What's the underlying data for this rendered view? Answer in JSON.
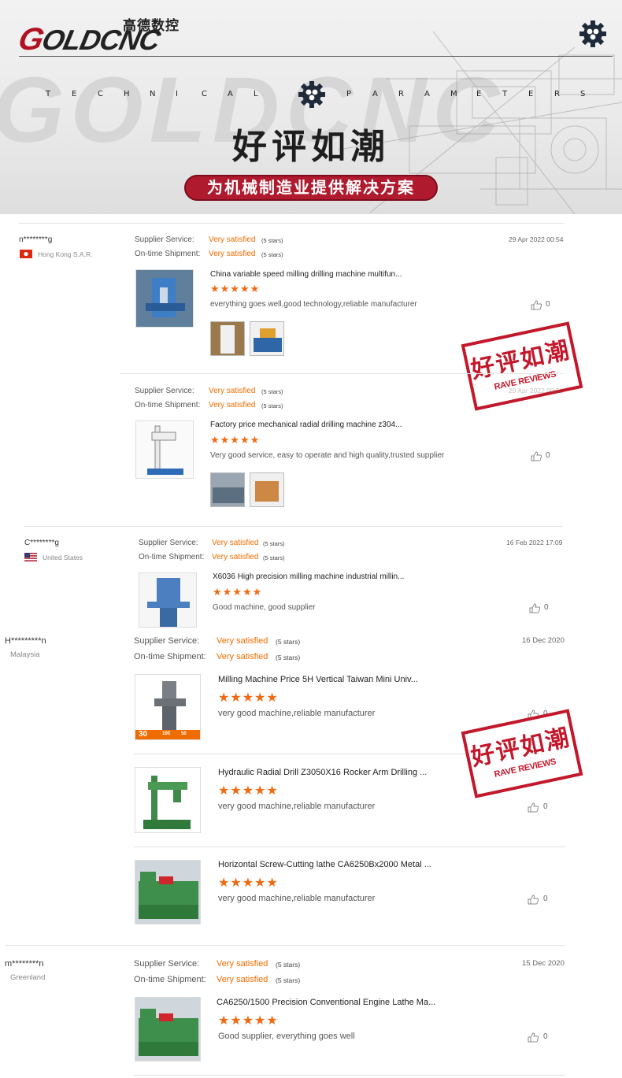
{
  "brand": {
    "logo_cn": "高德数控",
    "logo_en": "GOLDCNC",
    "watermark": "GOLDCNC",
    "red": "#b01224",
    "orange": "#ef6c00"
  },
  "banner": {
    "tech_letters_left": [
      "T",
      "E",
      "C",
      "H",
      "N",
      "I",
      "C",
      "A",
      "L"
    ],
    "tech_letters_right": [
      "P",
      "A",
      "R",
      "A",
      "M",
      "E",
      "T",
      "E",
      "R",
      "S"
    ],
    "slogan": "好评如潮",
    "pill": "为机械制造业提供解决方案"
  },
  "stamp": {
    "title": "好评如潮",
    "subtitle": "RAVE REVIEWS"
  },
  "labels": {
    "supplier": "Supplier Service:",
    "shipment": "On-time Shipment:",
    "very": "Very satisfied",
    "five": "(5 stars)",
    "stars": "★★★★★"
  },
  "reviews": [
    {
      "user": "n********g",
      "country": "Hong Kong S.A.R.",
      "date": "29 Apr 2022 00:54",
      "items": [
        {
          "title": "China variable speed milling drilling machine multifun...",
          "text": "everything goes well,good technology,reliable manufacturer",
          "likes": "0"
        },
        {
          "title": "Factory price mechanical radial drilling machine z304...",
          "text": "Very good service, easy to operate and high quality,trusted supplier",
          "likes": "0",
          "date": "29 Apr 2022 00:51"
        }
      ]
    },
    {
      "user": "C********g",
      "country": "United States",
      "date": "16 Feb 2022 17:09",
      "items": [
        {
          "title": "X6036 High precision milling machine industrial millin...",
          "text": "Good machine, good supplier",
          "likes": "0"
        }
      ]
    },
    {
      "user": "H*********n",
      "country": "Malaysia",
      "date": "16 Dec 2020",
      "items": [
        {
          "title": "Milling Machine Price 5H  Vertical Taiwan Mini Univ...",
          "text": "very good machine,reliable manufacturer",
          "likes": "0",
          "badges": [
            "30",
            "100",
            "50"
          ]
        },
        {
          "title": "Hydraulic Radial Drill Z3050X16 Rocker Arm Drilling ...",
          "text": "very good machine,reliable manufacturer",
          "likes": "0"
        },
        {
          "title": "Horizontal Screw-Cutting lathe CA6250Bx2000 Metal ...",
          "text": "very good machine,reliable manufacturer",
          "likes": "0"
        }
      ]
    },
    {
      "user": "m********n",
      "country": "Greenland",
      "date": "15 Dec 2020",
      "items": [
        {
          "title": "CA6250/1500 Precision Conventional Engine Lathe Ma...",
          "text": "Good supplier, everything goes well",
          "likes": "0"
        }
      ]
    }
  ]
}
